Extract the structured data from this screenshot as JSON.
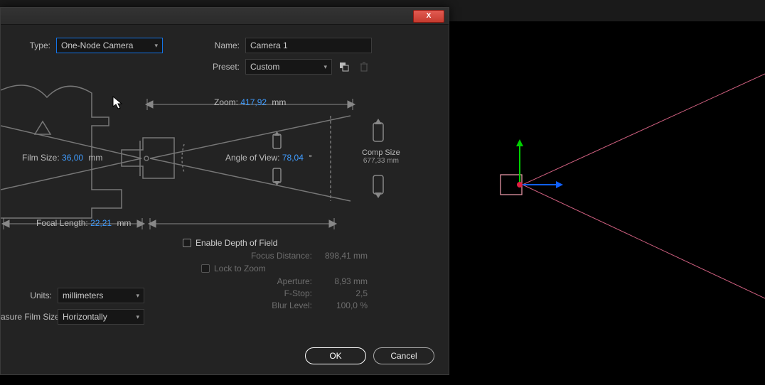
{
  "dialog": {
    "close": "X",
    "type_label": "Type:",
    "type_value": "One-Node Camera",
    "name_label": "Name:",
    "name_value": "Camera 1",
    "preset_label": "Preset:",
    "preset_value": "Custom"
  },
  "diagram": {
    "zoom_label": "Zoom:",
    "zoom_value": "417,92",
    "zoom_unit": "mm",
    "filmsize_label": "Film Size:",
    "filmsize_value": "36,00",
    "filmsize_unit": "mm",
    "angle_label": "Angle of View:",
    "angle_value": "78,04",
    "angle_unit": "°",
    "compsize_label": "Comp Size",
    "compsize_value": "677,33 mm",
    "focal_label": "Focal Length:",
    "focal_value": "22,21",
    "focal_unit": "mm"
  },
  "dof": {
    "enable_label": "Enable Depth of Field",
    "focusdist_label": "Focus Distance:",
    "focusdist_value": "898,41 mm",
    "lock_label": "Lock to Zoom",
    "aperture_label": "Aperture:",
    "aperture_value": "8,93 mm",
    "fstop_label": "F-Stop:",
    "fstop_value": "2,5",
    "blur_label": "Blur Level:",
    "blur_value": "100,0 %"
  },
  "units": {
    "units_label": "Units:",
    "units_value": "millimeters",
    "measure_label": "asure Film Size:",
    "measure_value": "Horizontally"
  },
  "buttons": {
    "ok": "OK",
    "cancel": "Cancel"
  }
}
